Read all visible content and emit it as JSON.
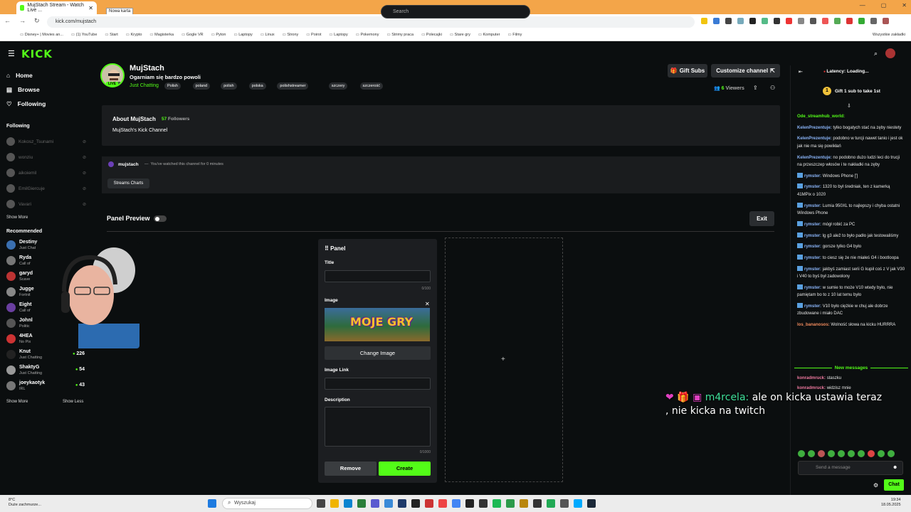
{
  "browser": {
    "tab_title": "MujStach Stream - Watch Live ...",
    "tooltip": "Nowa karta",
    "url": "kick.com/mujstach",
    "bookmarks": [
      "Disney+ | Movies an...",
      "(1) YouTube",
      "Start",
      "Krypto",
      "Magisterka",
      "Gogle VR",
      "Pyton",
      "Laptopy",
      "Linux",
      "Strony",
      "Poirot",
      "Laptopy",
      "Pokemony",
      "Strimy praca",
      "Polecajki",
      "Stare gry",
      "Komputer",
      "Filmy"
    ],
    "bookmarks_right": "Wszystkie zakładki"
  },
  "header": {
    "logo": "KICK",
    "search_placeholder": "Search"
  },
  "sidebar": {
    "nav": [
      {
        "label": "Home",
        "icon": "home-icon"
      },
      {
        "label": "Browse",
        "icon": "browse-icon"
      },
      {
        "label": "Following",
        "icon": "heart-icon"
      }
    ],
    "following_title": "Following",
    "following": [
      "Kokosz_Tsunami",
      "wonziu",
      "aikoiemil",
      "EmilGiercuje",
      "Vavari"
    ],
    "show_more": "Show More",
    "recommended_title": "Recommended",
    "recommended": [
      {
        "name": "Destiny",
        "category": "Just Chatting",
        "viewers": "",
        "color": "#3a6fb0"
      },
      {
        "name": "Ryda",
        "category": "Call of",
        "viewers": "",
        "color": "#777"
      },
      {
        "name": "garyd",
        "category": "Scave",
        "viewers": "",
        "color": "#b33"
      },
      {
        "name": "Jugge",
        "category": "Fortnit",
        "viewers": "",
        "color": "#888"
      },
      {
        "name": "Eight",
        "category": "Call of",
        "viewers": "",
        "color": "#6a3fa0"
      },
      {
        "name": "Johnl",
        "category": "Politic",
        "viewers": "",
        "color": "#555"
      },
      {
        "name": "4HEA",
        "category": "No Pix",
        "viewers": "",
        "color": "#c33"
      },
      {
        "name": "Knut",
        "category": "Just Chatting",
        "viewers": "226",
        "color": "#222"
      },
      {
        "name": "ShaktyG",
        "category": "Just Chatting",
        "viewers": "54",
        "color": "#999"
      },
      {
        "name": "joeykaotyk",
        "category": "IRL",
        "viewers": "43",
        "color": "#777"
      }
    ],
    "show_more_2": "Show More",
    "show_less": "Show Less"
  },
  "channel": {
    "name": "MujStach",
    "live": "LIVE",
    "title": "Ogarniam się bardzo powoli",
    "category": "Just Chatting",
    "tags": [
      "Polish",
      "poland",
      "polish",
      "polska",
      "polishstreamer",
      "szczery",
      "szczerość"
    ],
    "gift_label": "Gift Subs",
    "customize_label": "Customize channel",
    "viewers": "6",
    "viewers_label": "Viewers",
    "about_title": "About MujStach",
    "followers": "57",
    "followers_label": "Followers",
    "about_desc": "MujStach's Kick Channel",
    "watch_user": "mujstach",
    "watch_text": "You've watched this channel for 0 minutes",
    "streams_charts": "Streams Charts"
  },
  "panel_preview": {
    "label": "Panel Preview",
    "exit": "Exit",
    "panel_header": "Panel",
    "title_label": "Title",
    "title_value": "",
    "title_count": "0/100",
    "image_label": "Image",
    "image_text": "MOJE GRY",
    "change_image": "Change Image",
    "link_label": "Image Link",
    "link_value": "",
    "desc_label": "Description",
    "desc_value": "",
    "desc_count": "0/1000",
    "remove": "Remove",
    "create": "Create"
  },
  "chat": {
    "latency": "Latency: Loading...",
    "gift_banner": "Gift 1 sub to take 1st",
    "gift_count": "1",
    "messages": [
      {
        "user": "Ode_streamhub_world",
        "text": "",
        "color": "#53fc18",
        "badge": false
      },
      {
        "user": "KelenPrezentuje",
        "text": "tylko bogatych stać na zęby niestety",
        "color": "#8ab4f8",
        "badge": false
      },
      {
        "user": "KelenPrezentuje",
        "text": "podobno w turcji nawet tanio i jest ok jak nie ma się powikłań",
        "color": "#8ab4f8",
        "badge": false
      },
      {
        "user": "KelenPrezentuje",
        "text": "no podobno dużo ludzi leci do trucji na przeszczep włosów i te nakładki na zęby",
        "color": "#8ab4f8",
        "badge": false
      },
      {
        "user": "rymster",
        "text": "Windows Phone [']",
        "color": "#8ab4f8",
        "badge": true
      },
      {
        "user": "rymster",
        "text": "1320 to był średniak, ten z kamerką 41MPix o 1020",
        "color": "#8ab4f8",
        "badge": true
      },
      {
        "user": "rymster",
        "text": "Lumia 950XL to najlepszy i chyba ostatni Windows Phone",
        "color": "#8ab4f8",
        "badge": true
      },
      {
        "user": "rymster",
        "text": "mógł robić za PC",
        "color": "#8ab4f8",
        "badge": true
      },
      {
        "user": "rymster",
        "text": "lg g3 alež to było padło jak testowaliśmy",
        "color": "#8ab4f8",
        "badge": true
      },
      {
        "user": "rymster",
        "text": "gorsze tylko G4 było",
        "color": "#8ab4f8",
        "badge": true
      },
      {
        "user": "rymster",
        "text": "to ciesz się że nie miałeś G4 i bootloopa",
        "color": "#8ab4f8",
        "badge": true
      },
      {
        "user": "rymster",
        "text": "jakbyś zamiast serii G kupił coś z V jak V30 i V40 to byś był zadowolony",
        "color": "#8ab4f8",
        "badge": true
      },
      {
        "user": "rymster",
        "text": "w sumie to może V10 wtedy było, nie pamiętam bo to z 10 lat temu było",
        "color": "#8ab4f8",
        "badge": true
      },
      {
        "user": "rymster",
        "text": "V10 było ciężkie w chuj ale dobrze zbudowane i miało DAC",
        "color": "#8ab4f8",
        "badge": true
      },
      {
        "user": "los_bananosos",
        "text": "Wolność słowa na kicku HURRRA",
        "color": "#f08a5d",
        "badge": false
      }
    ],
    "new_messages_label": "New messages",
    "new_messages": [
      {
        "user": "konradmruck",
        "text": "staszku",
        "color": "#f07aa0"
      },
      {
        "user": "konradmruck",
        "text": "widzisz mnie",
        "color": "#f07aa0"
      }
    ],
    "overlay_user": "m4rcela:",
    "overlay_text": "ale on kicka ustawia teraz",
    "overlay_text2": ", nie kicka na twitch",
    "send_placeholder": "Send a message",
    "chat_button": "Chat"
  },
  "taskbar": {
    "temp": "8°C",
    "weather": "Duże zachmurze...",
    "search": "Wyszukaj",
    "time": "19:34",
    "date": "18.05.2025"
  }
}
